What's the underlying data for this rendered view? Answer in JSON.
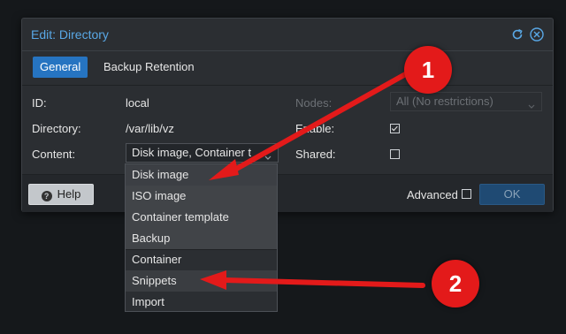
{
  "dialog": {
    "title": "Edit: Directory",
    "tabs": [
      "General",
      "Backup Retention"
    ],
    "fields": {
      "id_label": "ID:",
      "id_value": "local",
      "directory_label": "Directory:",
      "directory_value": "/var/lib/vz",
      "content_label": "Content:",
      "content_value": "Disk image, Container t",
      "nodes_label": "Nodes:",
      "nodes_value": "All (No restrictions)",
      "enable_label": "Enable:",
      "enable_checked": true,
      "shared_label": "Shared:",
      "shared_checked": false
    },
    "footer": {
      "help_label": "Help",
      "advanced_label": "Advanced",
      "ok_label": "OK"
    }
  },
  "dropdown": {
    "items": [
      "Disk image",
      "ISO image",
      "Container template",
      "Backup",
      "Container",
      "Snippets",
      "Import"
    ]
  },
  "annotations": {
    "badges": [
      "1",
      "2"
    ],
    "color": "#e31a1a"
  },
  "colors": {
    "accent": "#2674c1",
    "title": "#59a8e6",
    "background": "#2b2e32"
  }
}
